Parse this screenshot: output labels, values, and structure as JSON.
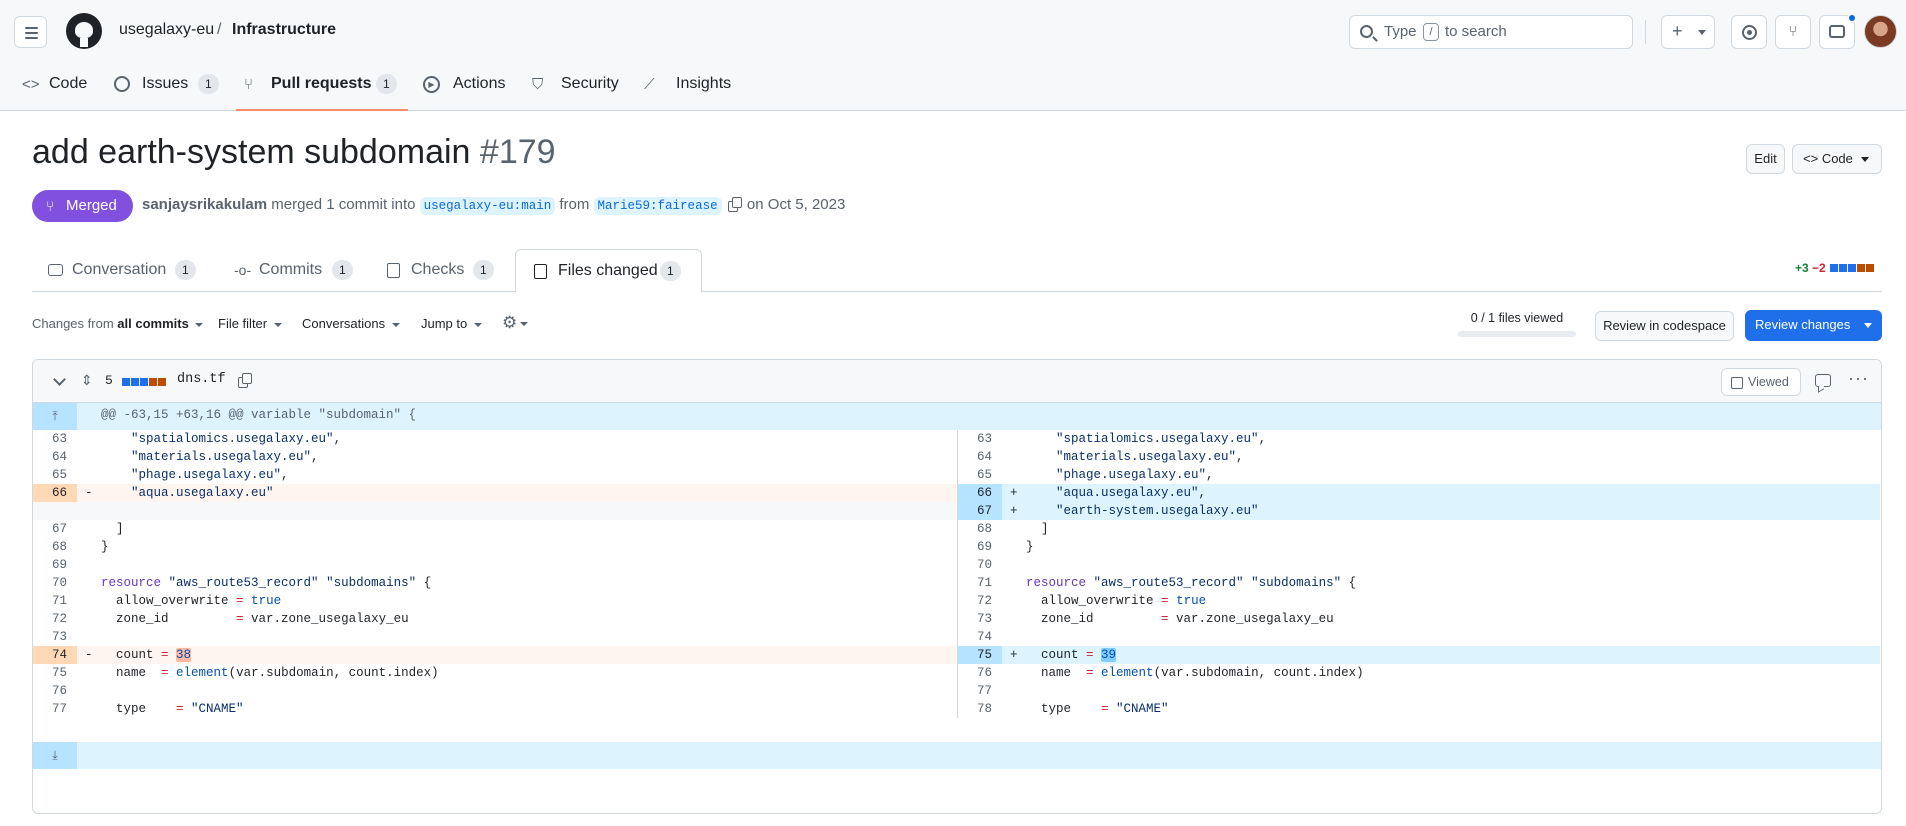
{
  "header": {
    "org": "usegalaxy-eu",
    "separator": "/",
    "repo": "Infrastructure",
    "search_type": "Type",
    "search_key": "/",
    "search_rest": "to search"
  },
  "repo_tabs": [
    {
      "label": "Code",
      "icon": "code-icon"
    },
    {
      "label": "Issues",
      "count": "1",
      "icon": "issue-icon"
    },
    {
      "label": "Pull requests",
      "count": "1",
      "icon": "pull-request-icon"
    },
    {
      "label": "Actions",
      "icon": "play-icon"
    },
    {
      "label": "Security",
      "icon": "shield-icon"
    },
    {
      "label": "Insights",
      "icon": "graph-icon"
    }
  ],
  "pr": {
    "title": "add earth-system subdomain",
    "number": "#179",
    "edit_label": "Edit",
    "code_label": "Code",
    "status": "Merged",
    "author": "sanjaysrikakulam",
    "merged_text": "merged 1 commit into",
    "base_branch": "usegalaxy-eu:main",
    "from_text": "from",
    "head_branch": "Marie59:fairease",
    "date_text": "on Oct 5, 2023"
  },
  "pr_tabs": [
    {
      "label": "Conversation",
      "count": "1",
      "icon": "comment-icon"
    },
    {
      "label": "Commits",
      "count": "1",
      "icon": "commit-icon"
    },
    {
      "label": "Checks",
      "count": "1",
      "icon": "checklist-icon"
    },
    {
      "label": "Files changed",
      "count": "1",
      "icon": "file-diff-icon"
    }
  ],
  "diffstat": {
    "additions": "+3",
    "deletions": "−2"
  },
  "toolbar": {
    "changes_prefix": "Changes from",
    "changes_value": "all commits",
    "file_filter": "File filter",
    "conversations": "Conversations",
    "jump_to": "Jump to",
    "files_viewed": "0 / 1 files viewed",
    "review_codespace": "Review in codespace",
    "review_changes": "Review changes"
  },
  "file": {
    "changes_count": "5",
    "name": "dns.tf",
    "viewed_label": "Viewed",
    "hunk_header": "@@ -63,15 +63,16 @@ variable \"subdomain\" {"
  },
  "colors": {
    "accent": "#0969da",
    "merged": "#8250df",
    "addition": "#1a7f37",
    "deletion": "#cf222e",
    "active_tab_underline": "#fd8c73"
  },
  "diff_left": [
    {
      "num": "63",
      "type": "ctx",
      "code": "    \"spatialomics.usegalaxy.eu\","
    },
    {
      "num": "64",
      "type": "ctx",
      "code": "    \"materials.usegalaxy.eu\","
    },
    {
      "num": "65",
      "type": "ctx",
      "code": "    \"phage.usegalaxy.eu\","
    },
    {
      "num": "66",
      "type": "del",
      "code": "    \"aqua.usegalaxy.eu\""
    },
    {
      "num": "",
      "type": "empty",
      "code": ""
    },
    {
      "num": "67",
      "type": "ctx",
      "code": "  ]"
    },
    {
      "num": "68",
      "type": "ctx",
      "code": "}"
    },
    {
      "num": "69",
      "type": "ctx",
      "code": ""
    },
    {
      "num": "70",
      "type": "ctx",
      "code": "resource \"aws_route53_record\" \"subdomains\" {"
    },
    {
      "num": "71",
      "type": "ctx",
      "code": "  allow_overwrite = true"
    },
    {
      "num": "72",
      "type": "ctx",
      "code": "  zone_id         = var.zone_usegalaxy_eu"
    },
    {
      "num": "73",
      "type": "ctx",
      "code": ""
    },
    {
      "num": "74",
      "type": "del",
      "code": "  count = 38"
    },
    {
      "num": "75",
      "type": "ctx",
      "code": "  name  = element(var.subdomain, count.index)"
    },
    {
      "num": "76",
      "type": "ctx",
      "code": ""
    },
    {
      "num": "77",
      "type": "ctx",
      "code": "  type    = \"CNAME\""
    }
  ],
  "diff_right": [
    {
      "num": "63",
      "type": "ctx",
      "code": "    \"spatialomics.usegalaxy.eu\","
    },
    {
      "num": "64",
      "type": "ctx",
      "code": "    \"materials.usegalaxy.eu\","
    },
    {
      "num": "65",
      "type": "ctx",
      "code": "    \"phage.usegalaxy.eu\","
    },
    {
      "num": "66",
      "type": "add",
      "code": "    \"aqua.usegalaxy.eu\","
    },
    {
      "num": "67",
      "type": "add",
      "code": "    \"earth-system.usegalaxy.eu\""
    },
    {
      "num": "68",
      "type": "ctx",
      "code": "  ]"
    },
    {
      "num": "69",
      "type": "ctx",
      "code": "}"
    },
    {
      "num": "70",
      "type": "ctx",
      "code": ""
    },
    {
      "num": "71",
      "type": "ctx",
      "code": "resource \"aws_route53_record\" \"subdomains\" {"
    },
    {
      "num": "72",
      "type": "ctx",
      "code": "  allow_overwrite = true"
    },
    {
      "num": "73",
      "type": "ctx",
      "code": "  zone_id         = var.zone_usegalaxy_eu"
    },
    {
      "num": "74",
      "type": "ctx",
      "code": ""
    },
    {
      "num": "75",
      "type": "add",
      "code": "  count = 39"
    },
    {
      "num": "76",
      "type": "ctx",
      "code": "  name  = element(var.subdomain, count.index)"
    },
    {
      "num": "77",
      "type": "ctx",
      "code": ""
    },
    {
      "num": "78",
      "type": "ctx",
      "code": "  type    = \"CNAME\""
    }
  ]
}
